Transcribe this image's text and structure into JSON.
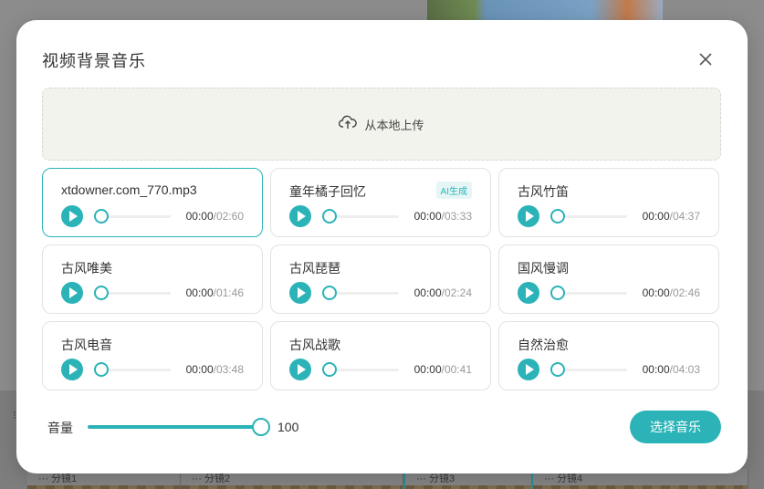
{
  "background": {
    "storyboard_labels": [
      "··· 分镜1",
      "··· 分镜2",
      "··· 分镜3",
      "··· 分镜4"
    ]
  },
  "modal": {
    "title": "视频背景音乐",
    "close_icon": "close-icon",
    "upload": {
      "icon": "cloud-upload-icon",
      "label": "从本地上传"
    },
    "tracks": [
      {
        "name": "xtdowner.com_770.mp3",
        "current": "00:00",
        "total": "/02:60",
        "badge": "",
        "selected": true
      },
      {
        "name": "童年橘子回忆",
        "current": "00:00",
        "total": "/03:33",
        "badge": "AI生成",
        "selected": false
      },
      {
        "name": "古风竹笛",
        "current": "00:00",
        "total": "/04:37",
        "badge": "",
        "selected": false
      },
      {
        "name": "古风唯美",
        "current": "00:00",
        "total": "/01:46",
        "badge": "",
        "selected": false
      },
      {
        "name": "古风琵琶",
        "current": "00:00",
        "total": "/02:24",
        "badge": "",
        "selected": false
      },
      {
        "name": "国风慢调",
        "current": "00:00",
        "total": "/02:46",
        "badge": "",
        "selected": false
      },
      {
        "name": "古风电音",
        "current": "00:00",
        "total": "/03:48",
        "badge": "",
        "selected": false
      },
      {
        "name": "古风战歌",
        "current": "00:00",
        "total": "/00:41",
        "badge": "",
        "selected": false
      },
      {
        "name": "自然治愈",
        "current": "00:00",
        "total": "/04:03",
        "badge": "",
        "selected": false
      }
    ],
    "volume": {
      "label": "音量",
      "value": "100",
      "level": 1.0
    },
    "select_button": "选择音乐"
  },
  "colors": {
    "accent": "#2bb3b8",
    "upload_bg": "#f3f3ee"
  }
}
